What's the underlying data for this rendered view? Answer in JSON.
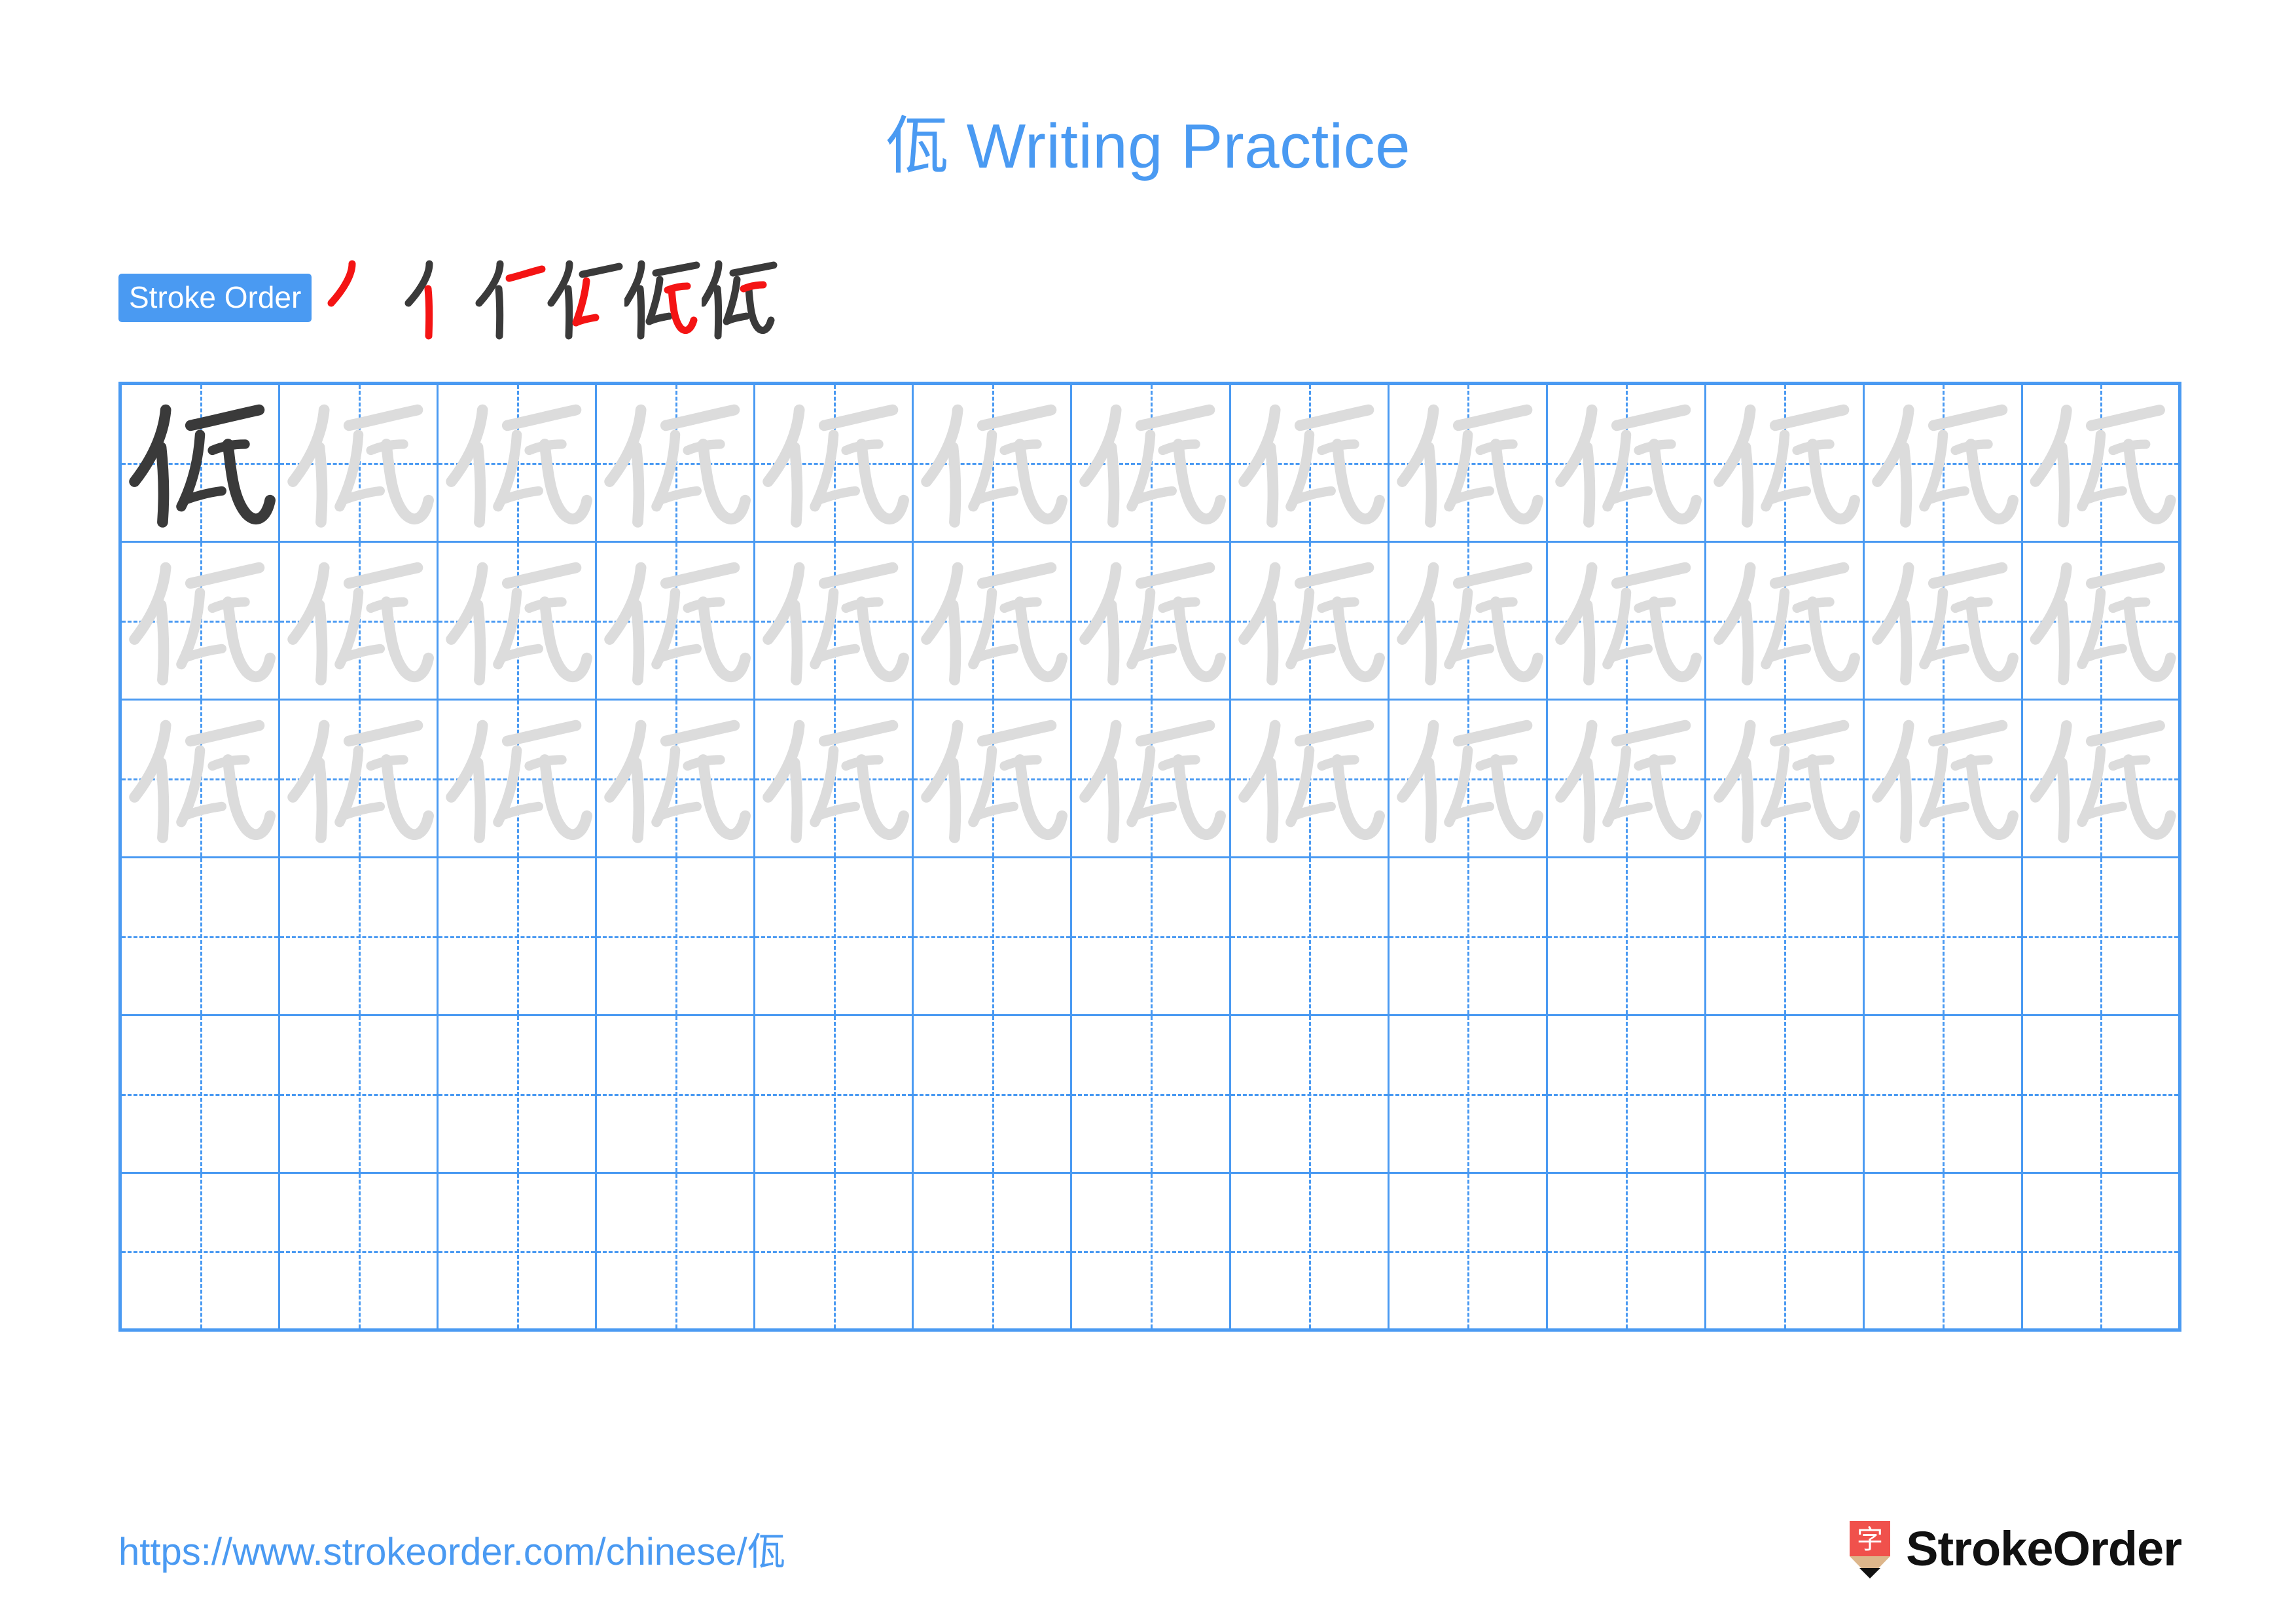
{
  "page": {
    "character": "佤",
    "title": "佤 Writing Practice",
    "title_suffix": "Writing Practice",
    "accent_color": "#4A9AF2",
    "ink_color": "#3A3A3A",
    "highlight_stroke_color": "#F41414",
    "trace_color": "#DCDCDC",
    "background_color": "#FFFFFF"
  },
  "stroke_order": {
    "badge_label": "Stroke Order",
    "total_strokes": 6,
    "steps": [
      {
        "index": 1,
        "strokes_shown": 1,
        "new_stroke": 1,
        "name": "丿 piě"
      },
      {
        "index": 2,
        "strokes_shown": 2,
        "new_stroke": 2,
        "name": "丨 shù"
      },
      {
        "index": 3,
        "strokes_shown": 3,
        "new_stroke": 3,
        "name": "一 héng"
      },
      {
        "index": 4,
        "strokes_shown": 4,
        "new_stroke": 4,
        "name": "丿 piě"
      },
      {
        "index": 5,
        "strokes_shown": 5,
        "new_stroke": 5,
        "name": "乚 shùwāngōu"
      },
      {
        "index": 6,
        "strokes_shown": 6,
        "new_stroke": 6,
        "name": "㇏ nà"
      }
    ]
  },
  "practice_grid": {
    "columns": 13,
    "rows": 6,
    "cells": [
      [
        "dark",
        "trace",
        "trace",
        "trace",
        "trace",
        "trace",
        "trace",
        "trace",
        "trace",
        "trace",
        "trace",
        "trace",
        "trace"
      ],
      [
        "trace",
        "trace",
        "trace",
        "trace",
        "trace",
        "trace",
        "trace",
        "trace",
        "trace",
        "trace",
        "trace",
        "trace",
        "trace"
      ],
      [
        "trace",
        "trace",
        "trace",
        "trace",
        "trace",
        "trace",
        "trace",
        "trace",
        "trace",
        "trace",
        "trace",
        "trace",
        "trace"
      ],
      [
        "empty",
        "empty",
        "empty",
        "empty",
        "empty",
        "empty",
        "empty",
        "empty",
        "empty",
        "empty",
        "empty",
        "empty",
        "empty"
      ],
      [
        "empty",
        "empty",
        "empty",
        "empty",
        "empty",
        "empty",
        "empty",
        "empty",
        "empty",
        "empty",
        "empty",
        "empty",
        "empty"
      ],
      [
        "empty",
        "empty",
        "empty",
        "empty",
        "empty",
        "empty",
        "empty",
        "empty",
        "empty",
        "empty",
        "empty",
        "empty",
        "empty"
      ]
    ]
  },
  "footer": {
    "url": "https://www.strokeorder.com/chinese/佤",
    "logo_text": "StrokeOrder",
    "logo_glyph": "字",
    "logo_color": "#F0514C",
    "logo_body_color": "#DDB68B"
  }
}
